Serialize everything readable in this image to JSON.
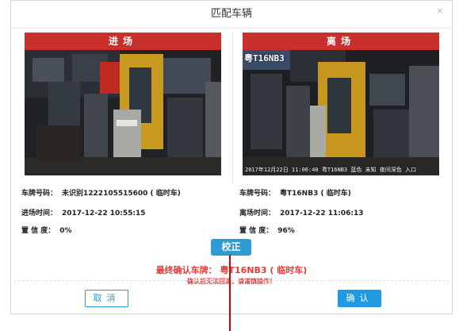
{
  "dialog": {
    "title": "匹配车辆",
    "close_glyph": "×"
  },
  "entry": {
    "header": "进场",
    "plate_label": "车牌号码：",
    "plate_value": "未识别1222105515600 ( 临时车)",
    "time_label": "进场时间：",
    "time_value": "2017-12-22 10:55:15",
    "confidence_label": "置 信 度：",
    "confidence_value": "0%"
  },
  "exit": {
    "header": "离场",
    "plate_label": "车牌号码：",
    "plate_value": "粤T16NB3 ( 临时车)",
    "time_label": "离场时间：",
    "time_value": "2017-12-22 11:06:13",
    "confidence_label": "置 信 度：",
    "confidence_value": "96%",
    "photo_overlay_plate": "粤T16NB3",
    "photo_caption": "2017年12月22日 11:06:40 粤T16NB3 蓝色 未知 夜间深色 入口"
  },
  "correct_button": "校正",
  "final_result": "最终确认车牌： 粤T16NB3 ( 临时车)",
  "warning": "确认后无法回退，请谨慎操作！",
  "buttons": {
    "cancel": "取消",
    "confirm": "确认"
  },
  "colors": {
    "header_red": "#c9302c",
    "primary_blue": "#2c9bd6",
    "alert_red": "#e23b3b"
  }
}
